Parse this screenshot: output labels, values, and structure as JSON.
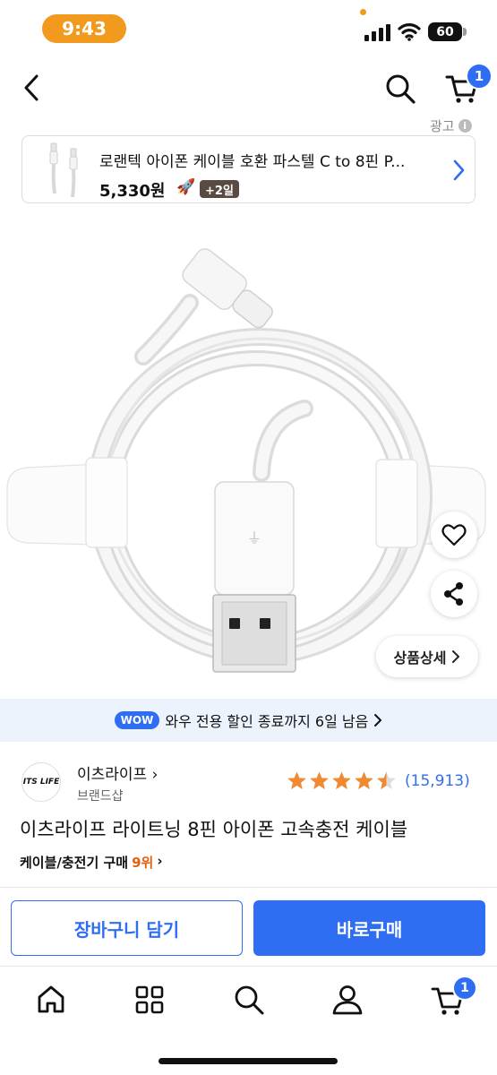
{
  "status_bar": {
    "time": "9:43",
    "battery": "60"
  },
  "header": {
    "back_icon": "chevron-left-icon",
    "search_icon": "search-icon",
    "cart_icon": "cart-icon",
    "cart_count": "1",
    "ad_label": "광고",
    "ad_info": "i"
  },
  "ad": {
    "title": "로랜텍 아이폰 케이블 호환 파스텔 C to 8핀 P...",
    "price": "5,330원",
    "rocket_icon": "rocket-icon",
    "delivery_days": "+2일"
  },
  "product_actions": {
    "wish_icon": "heart-icon",
    "share_icon": "share-icon",
    "detail_label": "상품상세"
  },
  "wow": {
    "badge": "WOW",
    "message": "와우 전용 할인 종료까지 6일 남음"
  },
  "seller": {
    "logo_text": "ITS LIFE",
    "name": "이츠라이프",
    "sub": "브랜드샵"
  },
  "rating": {
    "stars": 4.5,
    "count": "(15,913)"
  },
  "product": {
    "title": "이츠라이프 라이트닝 8핀 아이폰 고속충전 케이블",
    "rank_category": "케이블/충전기 구매",
    "rank": "9위"
  },
  "buttons": {
    "add_to_cart": "장바구니 담기",
    "buy_now": "바로구매"
  },
  "tab_bar": {
    "items": [
      "home-icon",
      "category-grid-icon",
      "search-icon",
      "my-account-icon",
      "cart-icon"
    ],
    "cart_count": "1"
  },
  "colors": {
    "accent": "#2f6ef3",
    "star": "#f08a32",
    "rank": "#e2600f",
    "time_pill": "#f19a1d"
  }
}
